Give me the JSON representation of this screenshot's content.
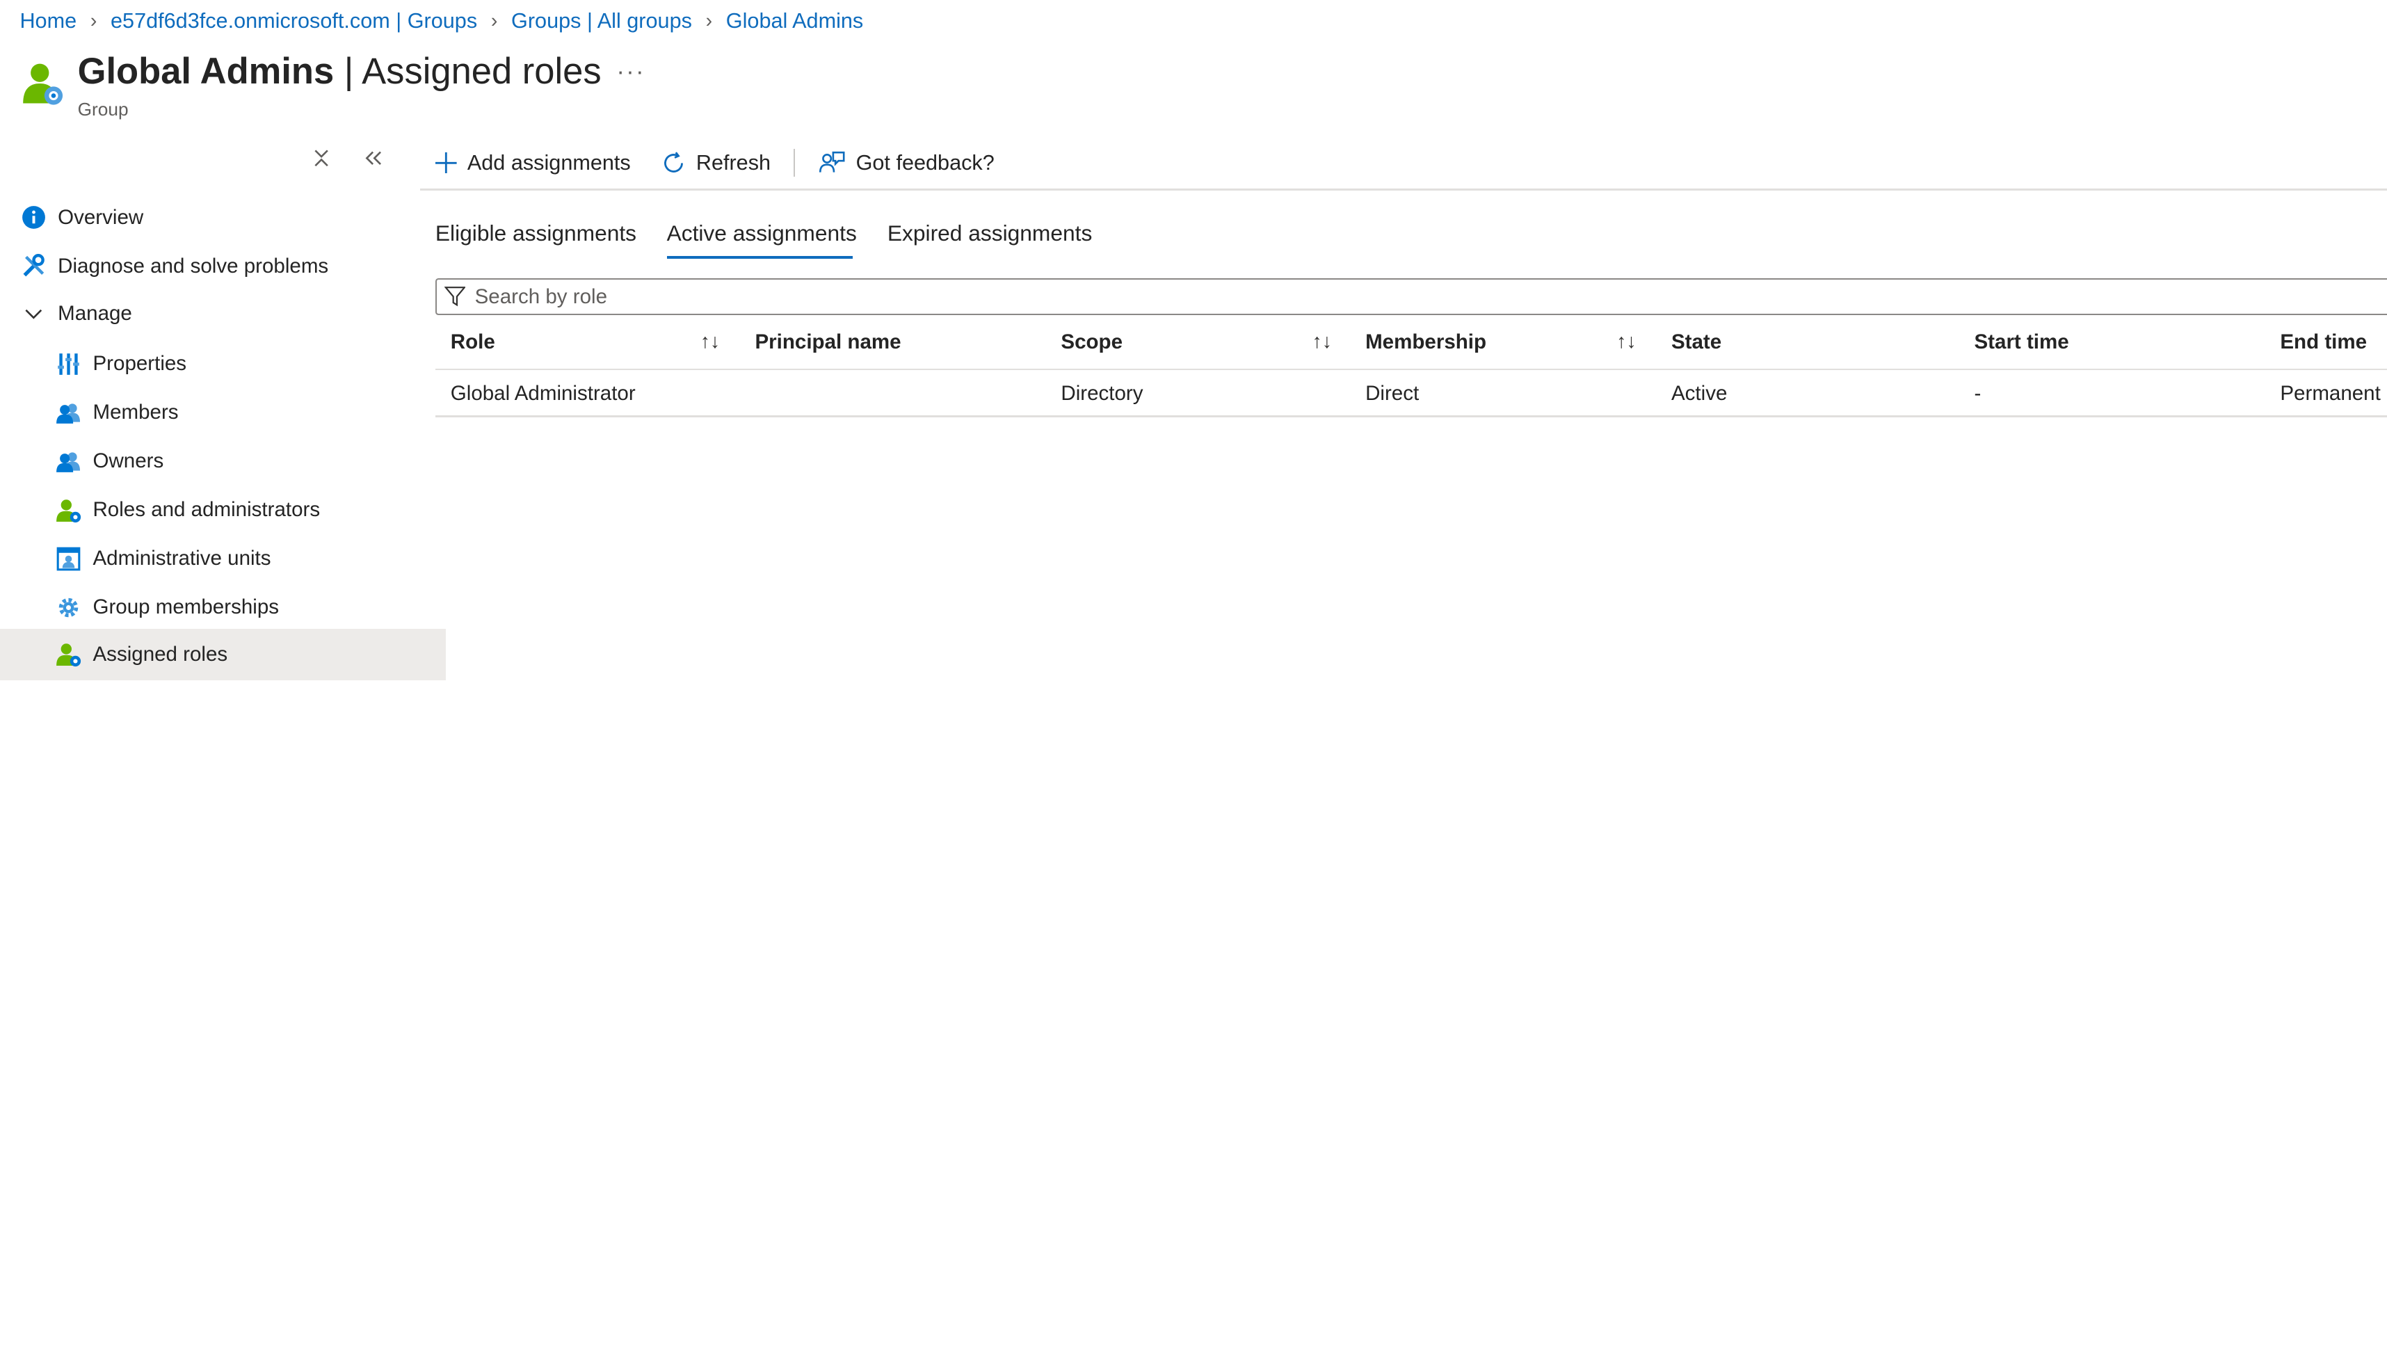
{
  "breadcrumb": [
    {
      "label": "Home"
    },
    {
      "label": "e57df6d3fce.onmicrosoft.com | Groups"
    },
    {
      "label": "Groups | All groups"
    },
    {
      "label": "Global Admins"
    }
  ],
  "header": {
    "title_strong": "Global Admins",
    "title_separator": " | ",
    "title_light": "Assigned roles",
    "more_label": "···",
    "subtitle": "Group"
  },
  "sidebar": {
    "collapse_all_glyph": "×",
    "collapse_glyph": "«",
    "items": [
      {
        "label": "Overview",
        "icon": "info-icon"
      },
      {
        "label": "Diagnose and solve problems",
        "icon": "wrench-icon"
      },
      {
        "label": "Manage",
        "icon": "chevron-down-icon"
      },
      {
        "label": "Properties",
        "icon": "properties-icon"
      },
      {
        "label": "Members",
        "icon": "members-icon"
      },
      {
        "label": "Owners",
        "icon": "owners-icon"
      },
      {
        "label": "Roles and administrators",
        "icon": "roles-icon"
      },
      {
        "label": "Administrative units",
        "icon": "admin-units-icon"
      },
      {
        "label": "Group memberships",
        "icon": "gear-icon"
      },
      {
        "label": "Assigned roles",
        "icon": "assigned-roles-icon",
        "selected": true
      }
    ]
  },
  "toolbar": {
    "add_label": "Add assignments",
    "refresh_label": "Refresh",
    "feedback_label": "Got feedback?"
  },
  "tabs": [
    {
      "label": "Eligible assignments"
    },
    {
      "label": "Active assignments",
      "active": true
    },
    {
      "label": "Expired assignments"
    }
  ],
  "search": {
    "placeholder": "Search by role",
    "value": ""
  },
  "table": {
    "columns": [
      "Role",
      "Principal name",
      "Scope",
      "Membership",
      "State",
      "Start time",
      "End time"
    ],
    "sort_glyph": "↑↓",
    "rows": [
      [
        "Global Administrator",
        "",
        "Directory",
        "Direct",
        "Active",
        "-",
        "Permanent"
      ]
    ]
  },
  "colors": {
    "accent": "#0f6cbd",
    "selected_bg": "#edebe9",
    "user_icon_green": "#6bb700",
    "icon_blue": "#0078d4"
  }
}
